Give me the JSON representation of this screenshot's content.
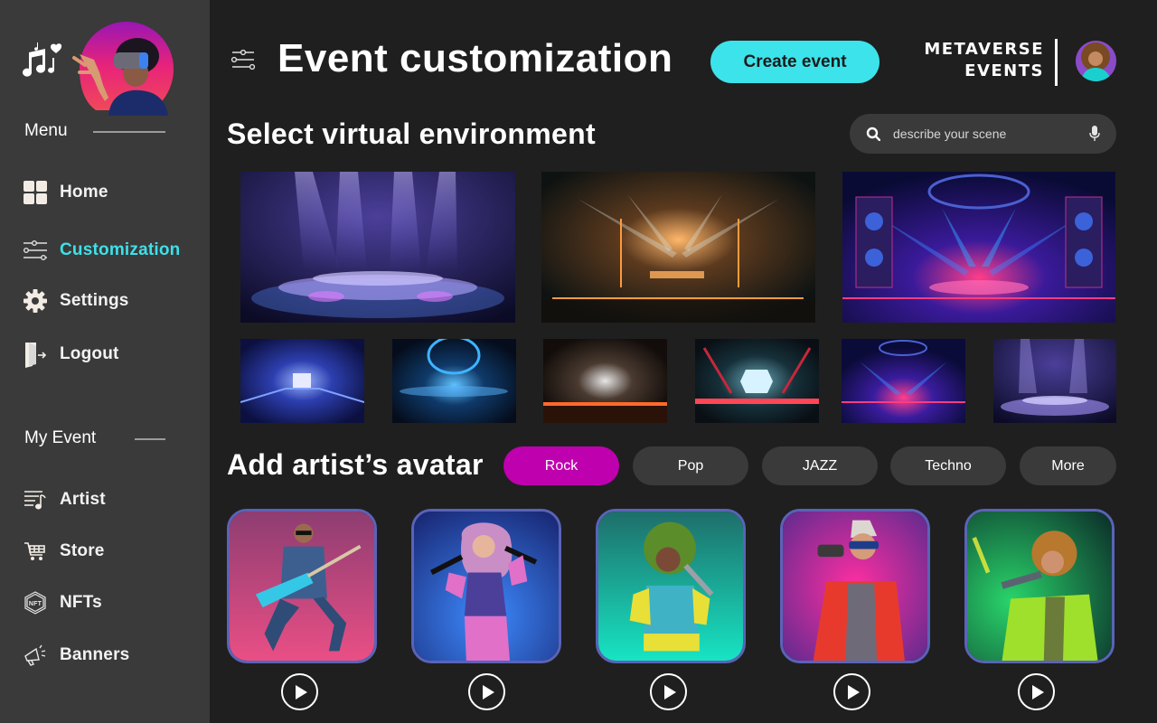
{
  "sidebar": {
    "menu_heading": "Menu",
    "menu_items": [
      {
        "label": "Home",
        "icon": "grid-icon",
        "active": false
      },
      {
        "label": "Customization",
        "icon": "sliders-icon",
        "active": true
      },
      {
        "label": "Settings",
        "icon": "gear-icon",
        "active": false
      },
      {
        "label": "Logout",
        "icon": "door-exit-icon",
        "active": false
      }
    ],
    "event_heading": "My Event",
    "event_items": [
      {
        "label": "Artist",
        "icon": "music-list-icon"
      },
      {
        "label": "Store",
        "icon": "cart-icon"
      },
      {
        "label": "NFTs",
        "icon": "nft-hexagon-icon"
      },
      {
        "label": "Banners",
        "icon": "megaphone-icon"
      }
    ]
  },
  "header": {
    "title": "Event customization",
    "create_button": "Create event",
    "brand_line1": "METAVERSE",
    "brand_line2": "EVENTS"
  },
  "environment": {
    "title": "Select virtual environment",
    "search_placeholder": "describe your scene",
    "featured_scenes": [
      {
        "name": "purple-round-stage"
      },
      {
        "name": "orange-neon-hall"
      },
      {
        "name": "pink-blue-concert-stage"
      }
    ],
    "thumbnail_scenes": [
      {
        "name": "blue-tunnel-stage"
      },
      {
        "name": "blue-ring-arena"
      },
      {
        "name": "smoky-orange-hall"
      },
      {
        "name": "red-hexagon-portal"
      },
      {
        "name": "pink-blue-concert-stage-small"
      },
      {
        "name": "purple-round-stage-small"
      }
    ]
  },
  "avatars": {
    "title": "Add artist’s avatar",
    "genres": [
      {
        "label": "Rock",
        "active": true
      },
      {
        "label": "Pop",
        "active": false
      },
      {
        "label": "JAZZ",
        "active": false
      },
      {
        "label": "Techno",
        "active": false
      },
      {
        "label": "More",
        "active": false
      }
    ],
    "artists": [
      {
        "name": "guitarist-rock-avatar"
      },
      {
        "name": "pink-singer-avatar"
      },
      {
        "name": "green-hair-singer-avatar"
      },
      {
        "name": "red-jacket-singer-avatar"
      },
      {
        "name": "lime-jacket-singer-avatar"
      }
    ]
  },
  "colors": {
    "accent_cyan": "#3de3ea",
    "accent_magenta": "#be00ae",
    "sidebar_bg": "#3a3a3a",
    "main_bg": "#1f1f1f",
    "card_border": "#5a63b8"
  }
}
